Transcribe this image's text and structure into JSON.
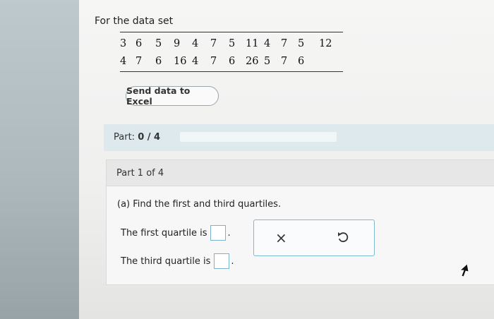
{
  "intro_text": "For the data set",
  "data_rows": [
    [
      "3",
      "6",
      "5",
      "9",
      "4",
      "7",
      "5",
      "11",
      "4",
      "7",
      "5",
      "12"
    ],
    [
      "4",
      "7",
      "6",
      "16",
      "4",
      "7",
      "6",
      "26",
      "5",
      "7",
      "6"
    ]
  ],
  "excel_button_label": "Send data to Excel",
  "part": {
    "prefix": "Part:",
    "score": "0 / 4",
    "progress_fraction": 0
  },
  "card": {
    "header": "Part 1 of 4",
    "question": "(a) Find the first and third quartiles.",
    "first_quartile_label": "The first quartile is",
    "third_quartile_label": "The third quartile is",
    "period": "."
  },
  "actions": {
    "clear_icon": "close-icon",
    "undo_icon": "undo-icon",
    "clear_glyph": "×"
  },
  "colors": {
    "accent": "#7fb8cf",
    "part_bar": "#dde9ed"
  }
}
